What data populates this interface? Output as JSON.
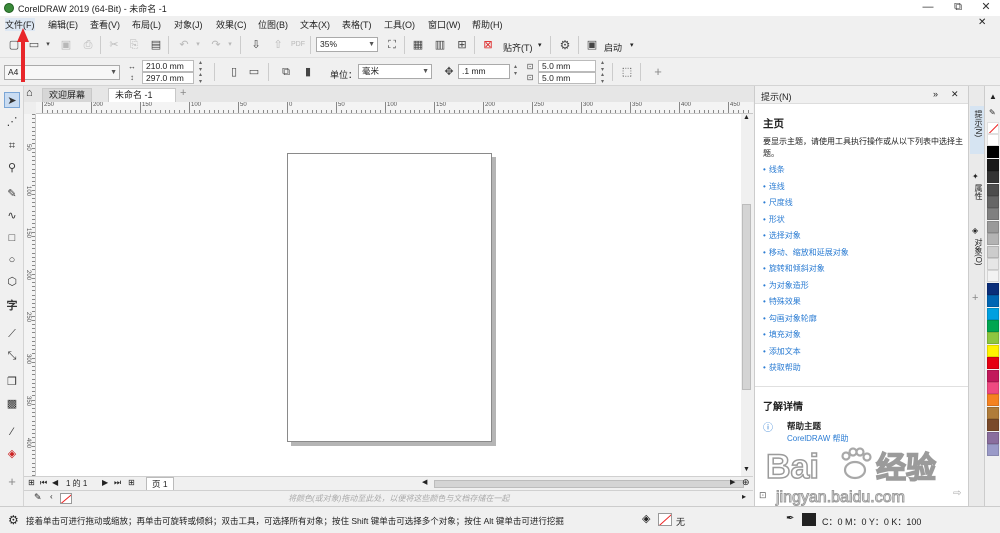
{
  "window": {
    "title": "CorelDRAW 2019 (64-Bit) - 未命名 -1",
    "controls": {
      "minimize": "—",
      "restore": "⧉",
      "close": "✕"
    }
  },
  "menu": [
    {
      "label": "文件(F)"
    },
    {
      "label": "编辑(E)"
    },
    {
      "label": "查看(V)"
    },
    {
      "label": "布局(L)"
    },
    {
      "label": "对象(J)"
    },
    {
      "label": "效果(C)"
    },
    {
      "label": "位图(B)"
    },
    {
      "label": "文本(X)"
    },
    {
      "label": "表格(T)"
    },
    {
      "label": "工具(O)"
    },
    {
      "label": "窗口(W)"
    },
    {
      "label": "帮助(H)"
    }
  ],
  "toolbar1": {
    "zoom": "35%",
    "snap_label": "贴齐(T)",
    "launch_label": "启动"
  },
  "toolbar2": {
    "page_size": "A4",
    "width": "210.0 mm",
    "height": "297.0 mm",
    "units_label": "单位：",
    "units_value": "毫米",
    "nudge": ".1 mm",
    "dup_x": "5.0 mm",
    "dup_y": "5.0 mm"
  },
  "tabs": [
    {
      "label": "欢迎屏幕"
    },
    {
      "label": "未命名 -1"
    }
  ],
  "rulers": {
    "h_labels": [
      "250",
      "200",
      "150",
      "100",
      "50",
      "0",
      "50",
      "100",
      "150",
      "200",
      "250",
      "300",
      "350",
      "400",
      "450"
    ],
    "v_labels": [
      "50",
      "100",
      "150",
      "200",
      "250",
      "300",
      "350",
      "400"
    ],
    "v_unit": "毫米"
  },
  "pagenav": {
    "text": "1 的 1",
    "page_tab": "页 1"
  },
  "colorbar": {
    "hint": "将颜色(或对象)拖动至此处，以便将这些颜色与文档存储在一起"
  },
  "hints_panel": {
    "header": "提示(N)",
    "home_title": "主页",
    "intro": "要显示主题，请使用工具执行操作或从以下列表中选择主题。",
    "links": [
      "线条",
      "连线",
      "尺度线",
      "形状",
      "选择对象",
      "移动、缩放和延展对象",
      "旋转和倾斜对象",
      "为对象造形",
      "特殊效果",
      "勾画对象轮廓",
      "填充对象",
      "添加文本",
      "获取帮助"
    ],
    "learn_more": "了解详情",
    "help_topic": "帮助主题",
    "help_sub": "CorelDRAW 帮助"
  },
  "panel_tabs": [
    "提示(N)",
    "属性",
    "对象(O)"
  ],
  "palette": [
    "#ffffff",
    "#000000",
    "#1a1a1a",
    "#333333",
    "#4d4d4d",
    "#666666",
    "#808080",
    "#999999",
    "#b3b3b3",
    "#cccccc",
    "#e6e6e6",
    "#f2f2f2",
    "#0a2e7a",
    "#0066b3",
    "#00a0e0",
    "#00a651",
    "#8dc63f",
    "#fff200",
    "#e60012",
    "#c2185b",
    "#ef4a81",
    "#f58220",
    "#b07c3a",
    "#7a4a2a",
    "#8a6e9e",
    "#9a9ac8"
  ],
  "statusbar": {
    "message": "接着单击可进行拖动或缩放；再单击可旋转或倾斜；双击工具，可选择所有对象；按住 Shift 键单击可选择多个对象；按住 Alt 键单击可进行挖掘",
    "fill_label": "无",
    "outline_label": "C：0 M：0 Y：0 K：100"
  },
  "watermark": {
    "brand": "Baidu",
    "cn": "经验",
    "url": "jingyan.baidu.com"
  },
  "colors": {
    "accent": "#2b7cd3",
    "annotation": "#e8262a"
  }
}
